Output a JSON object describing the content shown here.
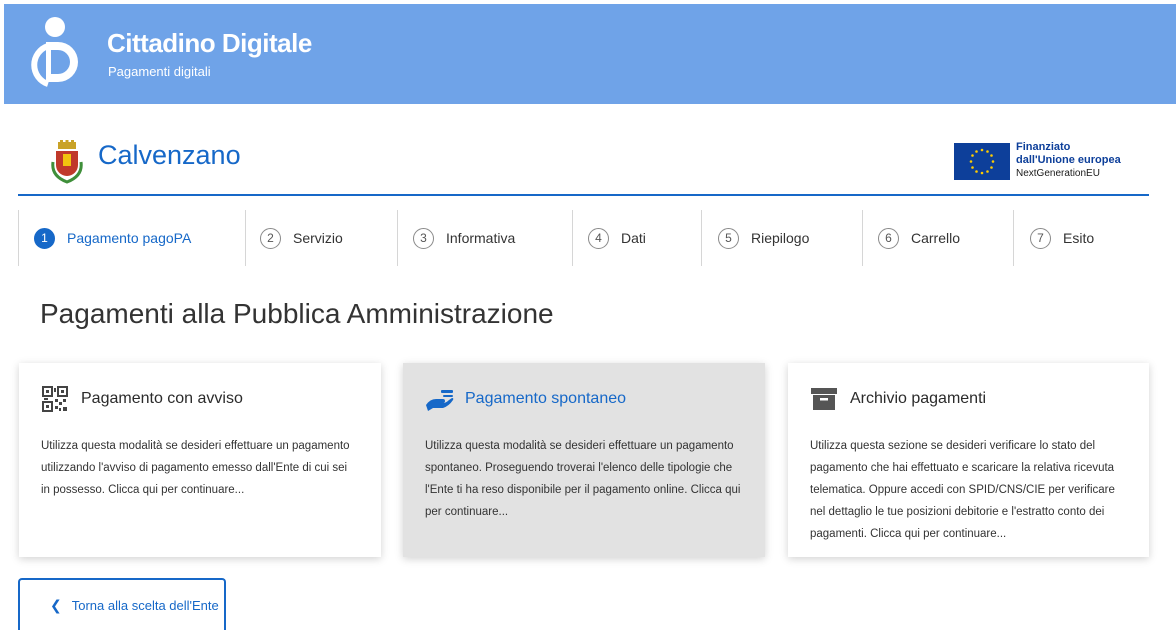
{
  "header": {
    "brand_title": "Cittadino Digitale",
    "brand_subtitle": "Pagamenti digitali",
    "bg_color": "#6fa3e8"
  },
  "municipality": {
    "name": "Calvenzano"
  },
  "eu_badge": {
    "line1": "Finanziato",
    "line2": "dall'Unione europea",
    "line3": "NextGenerationEU"
  },
  "steps": [
    {
      "num": "1",
      "label": "Pagamento pagoPA",
      "active": true
    },
    {
      "num": "2",
      "label": "Servizio"
    },
    {
      "num": "3",
      "label": "Informativa"
    },
    {
      "num": "4",
      "label": "Dati"
    },
    {
      "num": "5",
      "label": "Riepilogo"
    },
    {
      "num": "6",
      "label": "Carrello"
    },
    {
      "num": "7",
      "label": "Esito"
    }
  ],
  "page_title": "Pagamenti alla Pubblica Amministrazione",
  "cards": [
    {
      "title": "Pagamento con avviso",
      "icon": "qr-code-icon",
      "body": "Utilizza questa modalità se desideri effettuare un pagamento utilizzando l'avviso di pagamento emesso dall'Ente di cui sei in possesso. Clicca qui per continuare..."
    },
    {
      "title": "Pagamento spontaneo",
      "icon": "payment-hand-icon",
      "body": "Utilizza questa modalità se desideri effettuare un pagamento spontaneo. Proseguendo troverai l'elenco delle tipologie che l'Ente ti ha reso disponibile per il pagamento online. Clicca qui per continuare..."
    },
    {
      "title": "Archivio pagamenti",
      "icon": "archive-box-icon",
      "body": "Utilizza questa sezione se desideri verificare lo stato del pagamento che hai effettuato e scaricare la relativa ricevuta telematica. Oppure accedi con SPID/CNS/CIE per verificare nel dettaglio le tue posizioni debitorie e l'estratto conto dei pagamenti. Clicca qui per continuare..."
    }
  ],
  "back_button": {
    "label": "Torna alla scelta dell'Ente"
  },
  "colors": {
    "primary": "#1668c8",
    "eu_blue": "#0d3f9a",
    "eu_star": "#ffcc00"
  }
}
